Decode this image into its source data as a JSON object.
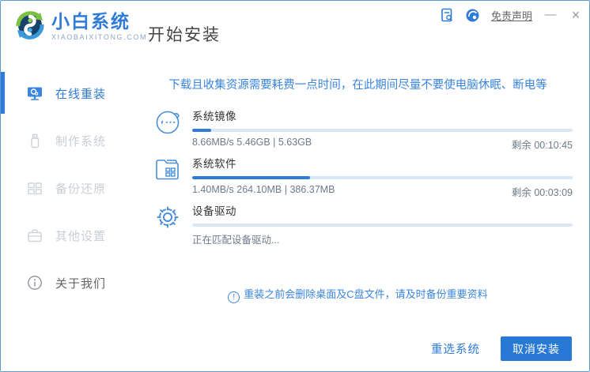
{
  "header": {
    "brand_name": "小白系统",
    "brand_domain": "XIAOBAIXITONG.COM",
    "page_title": "开始安装",
    "disclaimer_link": "免责声明",
    "minimize_label": "—",
    "close_label": "×"
  },
  "sidebar": {
    "items": [
      {
        "label": "在线重装",
        "icon": "monitor-reinstall-icon",
        "active": true
      },
      {
        "label": "制作系统",
        "icon": "usb-drive-icon",
        "active": false
      },
      {
        "label": "备份还原",
        "icon": "backup-grid-icon",
        "active": false
      },
      {
        "label": "其他设置",
        "icon": "briefcase-icon",
        "active": false
      },
      {
        "label": "关于我们",
        "icon": "info-icon",
        "active": false
      }
    ]
  },
  "main": {
    "notice": "下载且收集资源需要耗费一点时间，在此期间尽量不要使电脑休眠、断电等",
    "tasks": [
      {
        "icon": "mascot-face-icon",
        "title": "系统镜像",
        "stats": "8.66MB/s 5.46GB | 5.63GB",
        "remaining": "剩余 00:10:45",
        "progress_percent": 5
      },
      {
        "icon": "software-folder-icon",
        "title": "系统软件",
        "stats": "1.40MB/s 264.10MB | 386.37MB",
        "remaining": "剩余 00:03:09",
        "progress_percent": 31
      },
      {
        "icon": "gear-icon",
        "title": "设备驱动",
        "stats": "正在匹配设备驱动...",
        "remaining": "",
        "progress_percent": 0
      }
    ],
    "warning_icon": "!",
    "warning": "重装之前会删除桌面及C盘文件，请及时备份重要资料"
  },
  "footer": {
    "reselect_label": "重选系统",
    "cancel_label": "取消安装"
  },
  "colors": {
    "accent_blue": "#2f7bd8",
    "progress_fill": "#2f7bd8",
    "progress_track": "#d9e6f6",
    "inactive_gray": "#c9ced6",
    "border_blue": "#5b9bd5"
  }
}
